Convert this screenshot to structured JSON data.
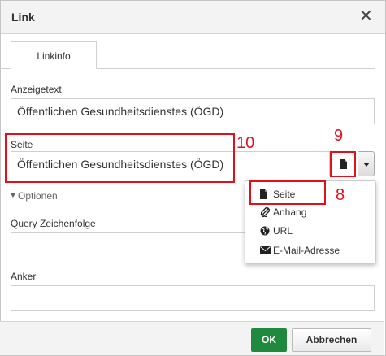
{
  "dialog": {
    "title": "Link"
  },
  "tabs": [
    {
      "label": "Linkinfo"
    }
  ],
  "fields": {
    "anzeigetext": {
      "label": "Anzeigetext",
      "value": "Öffentlichen Gesundheitsdienstes (ÖGD)"
    },
    "seite": {
      "label": "Seite",
      "value": "Öffentlichen Gesundheitsdienstes (ÖGD)"
    },
    "query": {
      "label": "Query Zeichenfolge",
      "value": ""
    },
    "anker": {
      "label": "Anker",
      "value": ""
    }
  },
  "optionen_label": "Optionen",
  "annotations": {
    "seite_box": "10",
    "page_button": "9",
    "menu_seite": "8",
    "color": "#e0101e"
  },
  "link_type_menu": [
    {
      "label": "Seite",
      "icon": "file-icon"
    },
    {
      "label": "Anhang",
      "icon": "paperclip-icon"
    },
    {
      "label": "URL",
      "icon": "globe-icon"
    },
    {
      "label": "E-Mail-Adresse",
      "icon": "envelope-icon"
    }
  ],
  "buttons": {
    "ok": "OK",
    "cancel": "Abbrechen"
  },
  "colors": {
    "ok_button": "#1f8a3d",
    "annotation_red": "#e0101e"
  }
}
